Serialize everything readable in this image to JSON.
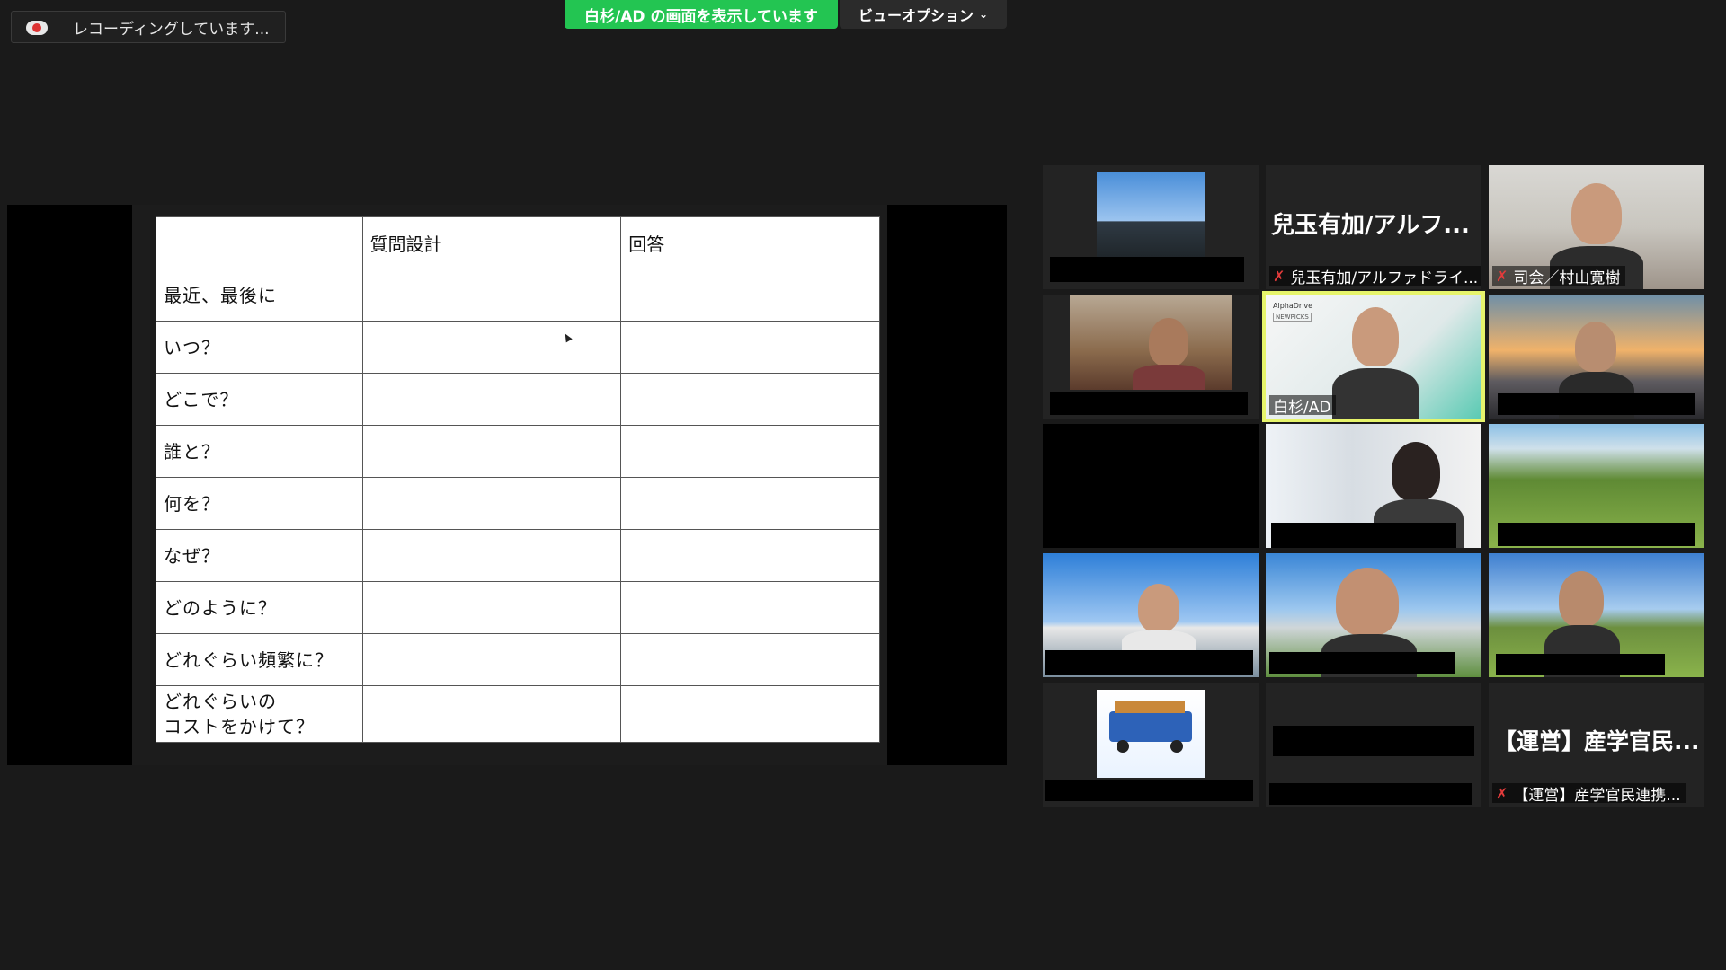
{
  "recording": {
    "label": "レコーディングしています..."
  },
  "share_banner": {
    "label": "白杉/AD の画面を表示しています"
  },
  "view_options": {
    "label": "ビューオプション",
    "chevron": "⌄"
  },
  "table": {
    "headers": [
      "",
      "質問設計",
      "回答"
    ],
    "rows": [
      "最近、最後に",
      "いつ？",
      "どこで？",
      "誰と？",
      "何を？",
      "なぜ？",
      "どのように？",
      "どれぐらい頻繁に？",
      "どれぐらいの\nコストをかけて？"
    ]
  },
  "participants": {
    "kodama": {
      "display_name": "兒玉有加/アルフ...",
      "name_label": "兒玉有加/アルファドライ..."
    },
    "host": {
      "name_label": "司会／村山寛樹"
    },
    "presenter": {
      "name_label": "白杉/AD",
      "slide_brand": "AlphaDrive",
      "slide_sub": "NEWPICKS"
    },
    "staff": {
      "display_name": "【運営】産学官民...",
      "name_label": "【運営】産学官民連携..."
    }
  },
  "mute_icon": "✗",
  "colors": {
    "share_green": "#23c552",
    "active_speaker": "#e6f46b",
    "mute_red": "#e23b3b"
  }
}
